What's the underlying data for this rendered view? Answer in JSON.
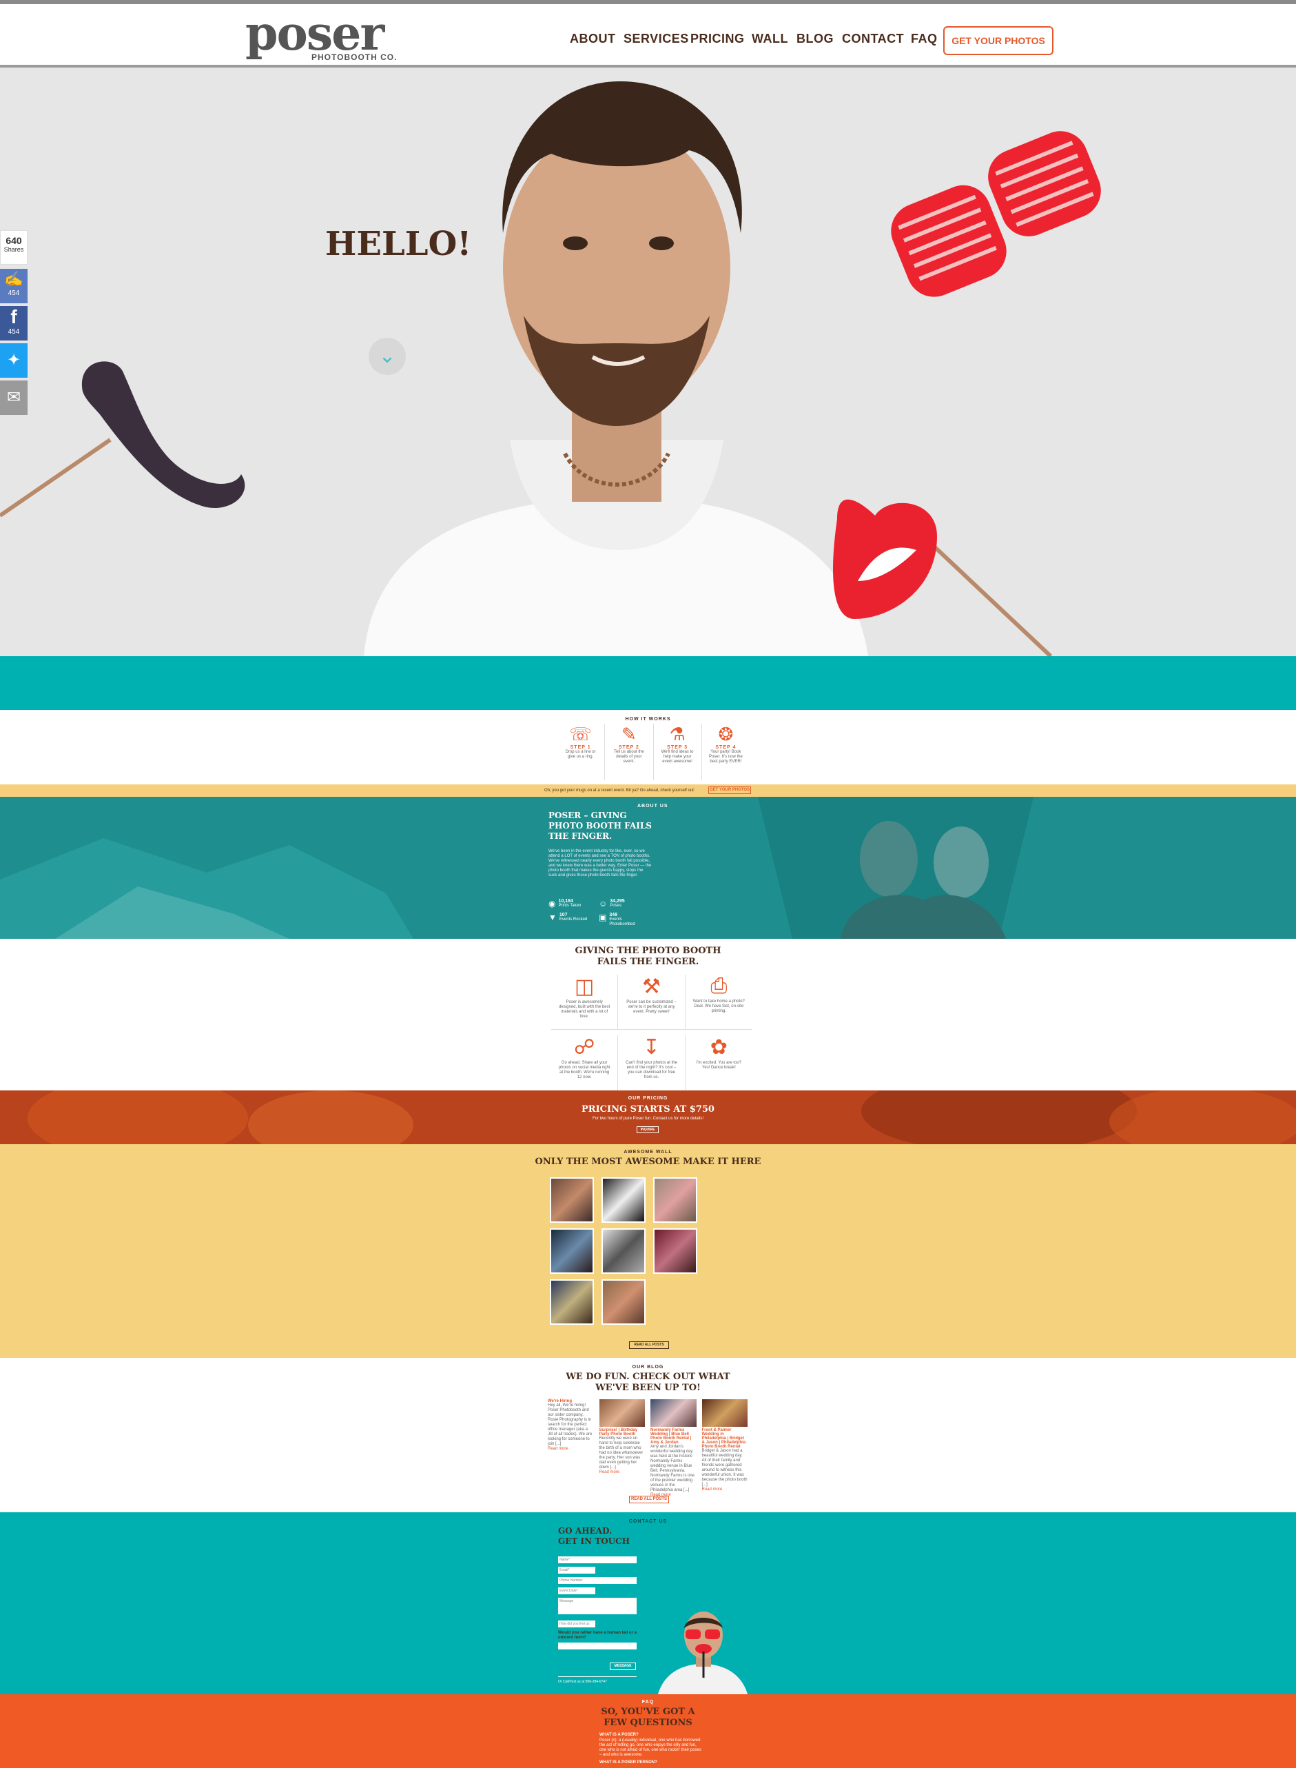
{
  "header": {
    "logo_word": "poser",
    "logo_sub": "PHOTOBOOTH CO.",
    "nav": [
      "ABOUT",
      "SERVICES",
      "PRICING",
      "WALL",
      "BLOG",
      "CONTACT",
      "FAQ"
    ],
    "cta": "GET YOUR PHOTOS"
  },
  "hero": {
    "title": "HELLO!",
    "arrow_icon": "chevron-down-icon"
  },
  "share": {
    "count": "640",
    "label": "Shares",
    "like_count": "454",
    "facebook_count": "454"
  },
  "how": {
    "kicker": "HOW IT WORKS",
    "steps": [
      {
        "title": "STEP 1",
        "text": "Drop us a line or give us a ring."
      },
      {
        "title": "STEP 2",
        "text": "Tell us about the details of your event."
      },
      {
        "title": "STEP 3",
        "text": "We'll find ideas to help make your event awesome!"
      },
      {
        "title": "STEP 4",
        "text": "Your party! Book Poser. It's now the best party EVER!"
      }
    ]
  },
  "promo": {
    "text": "Oh, you got your mugs on at a recent event. Bit ya? Go ahead, check yourself out:",
    "button": "GET YOUR PHOTOS"
  },
  "about": {
    "kicker": "ABOUT US",
    "title": "POSER – GIVING PHOTO BOOTH FAILS THE FINGER.",
    "body": "We've been in the event industry for like, ever, so we attend a LOT of events and see a TON of photo booths. We've witnessed nearly every photo booth fail possible, and we knew there was a better way. Enter Poser — the photo booth that makes the guests happy, stops the suck and gives those photo booth fails the finger.",
    "stats": [
      {
        "value": "10,184",
        "label": "Prints Taken"
      },
      {
        "value": "34,295",
        "label": "Poses"
      },
      {
        "value": "107",
        "label": "Events Rocked"
      },
      {
        "value": "348",
        "label": "Events Photobombed"
      }
    ]
  },
  "features": {
    "title": "GIVING THE PHOTO BOOTH FAILS THE FINGER.",
    "items": [
      {
        "icon": "booth-icon",
        "text": "Poser is awesomely designed, built with the best materials and with a lot of love."
      },
      {
        "icon": "tools-icon",
        "text": "Poser can be customized – we're to it perfectly at any event. Pretty sweet!"
      },
      {
        "icon": "printer-icon",
        "text": "Want to take home a photo? Deal. We have fast, on-site printing."
      },
      {
        "icon": "share-icon",
        "text": "Go ahead. Share all your photos on social media right at the booth. We're running 12 now."
      },
      {
        "icon": "download-icon",
        "text": "Can't find your photos at the end of the night? It's cool – you can download for free from us."
      },
      {
        "icon": "props-icon",
        "text": "I'm excited. You are too? Yes! Dance break!"
      }
    ]
  },
  "pricing": {
    "kicker": "OUR PRICING",
    "title": "PRICING STARTS AT $750",
    "sub": "For two hours of pure Poser fun. Contact us for more details!",
    "button": "INQUIRE"
  },
  "wall": {
    "kicker": "AWESOME WALL",
    "title": "ONLY THE MOST AWESOME MAKE IT HERE",
    "button": "READ ALL POSTS",
    "photo_count": 8
  },
  "blog": {
    "kicker": "OUR BLOG",
    "title": "WE DO FUN. CHECK OUT WHAT WE'VE BEEN UP TO!",
    "posts": [
      {
        "title": "We're Hiring",
        "text": "Hey all, We're hiring! Poser Photobooth and our sister company, Rosie Photography is in search for the perfect office manager (aka a Jill of all trades). We are looking for someone to join [...]",
        "more": "Read more"
      },
      {
        "title": "Surprise! | Birthday Party Photo Booth",
        "text": "Recently we were on hand to help celebrate the birth of a mom who had no idea whatsoever the party. Her son was dad even getting her down [...]",
        "more": "Read more"
      },
      {
        "title": "Normandy Farms Wedding | Blue Bell Photo Booth Rental | Amy & Jordan",
        "text": "Amy and Jordan's wonderful wedding day was held at the historic Normandy Farms wedding venue in Blue Bell, Pennsylvania. Normandy Farms is one of the premier wedding venues in the Philadelphia area [...]",
        "more": "Read more"
      },
      {
        "title": "Front & Palmer Wedding in Philadelphia | Bridget & Jason | Philadelphia Photo Booth Rental",
        "text": "Bridget & Jason had a beautiful wedding day. All of their family and friends were gathered around to witness this wonderful union. It was because the photo booth [...]",
        "more": "Read more"
      }
    ],
    "button": "READ ALL POSTS"
  },
  "contact": {
    "kicker": "CONTACT US",
    "title": "GO AHEAD. GET IN TOUCH",
    "fields": [
      "Name*",
      "Email*",
      "Phone Number",
      "Event Date*",
      "Message"
    ],
    "select": "How did you find us",
    "question": "Would you rather have a human tail or a unicorn horn?",
    "button": "MESSAGE",
    "phone": "Or Call/Text us at 856-284-6747"
  },
  "faq": {
    "kicker": "FAQ",
    "title": "SO, YOU'VE GOT A FEW QUESTIONS",
    "q1": "WHAT IS A POSER?",
    "a1": "Poser (n): a (usually) individual, one who has borrowed the act of letting go, one who enjoys the silly and fun, one who is not afraid of fun, one who rockin' their poses – and who is awesome.",
    "q2": "WHAT IS A POSER PERSON?"
  },
  "colors": {
    "teal": "#00b1b1",
    "dark_teal": "#1f8e8e",
    "orange": "#f05a24",
    "mustard": "#f5d37e",
    "brown": "#4a2c1d"
  }
}
